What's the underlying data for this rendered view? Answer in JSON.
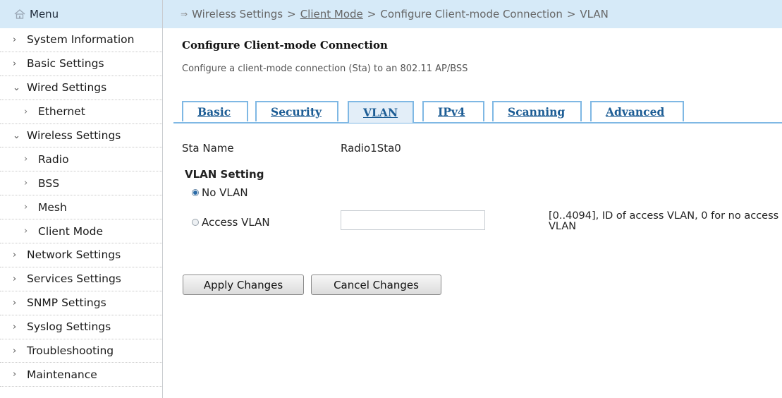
{
  "sidebar": {
    "header_label": "Menu",
    "items": [
      {
        "label": "System Information",
        "chevron": ">"
      },
      {
        "label": "Basic Settings",
        "chevron": ">"
      },
      {
        "label": "Wired Settings",
        "chevron": "v"
      },
      {
        "label": "Ethernet",
        "chevron": ">"
      },
      {
        "label": "Wireless Settings",
        "chevron": "v"
      },
      {
        "label": "Radio",
        "chevron": ">"
      },
      {
        "label": "BSS",
        "chevron": ">"
      },
      {
        "label": "Mesh",
        "chevron": ">"
      },
      {
        "label": "Client Mode",
        "chevron": ">"
      },
      {
        "label": "Network Settings",
        "chevron": ">"
      },
      {
        "label": "Services Settings",
        "chevron": ">"
      },
      {
        "label": "SNMP Settings",
        "chevron": ">"
      },
      {
        "label": "Syslog Settings",
        "chevron": ">"
      },
      {
        "label": "Troubleshooting",
        "chevron": ">"
      },
      {
        "label": "Maintenance",
        "chevron": ">"
      }
    ]
  },
  "breadcrumb": {
    "items": [
      "Wireless Settings",
      "Client Mode",
      "Configure Client-mode Connection",
      "VLAN"
    ],
    "separator": ">"
  },
  "page": {
    "title": "Configure Client-mode Connection",
    "description": "Configure a client-mode connection (Sta) to an 802.11 AP/BSS"
  },
  "tabs": [
    {
      "label": "Basic",
      "active": false
    },
    {
      "label": "Security",
      "active": false
    },
    {
      "label": "VLAN",
      "active": true
    },
    {
      "label": "IPv4",
      "active": false
    },
    {
      "label": "Scanning",
      "active": false
    },
    {
      "label": "Advanced",
      "active": false
    }
  ],
  "form": {
    "sta_name_label": "Sta Name",
    "sta_name_value": "Radio1Sta0",
    "vlan_setting_title": "VLAN Setting",
    "no_vlan_label": "No VLAN",
    "no_vlan_selected": true,
    "access_vlan_label": "Access VLAN",
    "access_vlan_selected": false,
    "access_vlan_value": "",
    "access_vlan_hint": "[0..4094], ID of access VLAN, 0 for no access VLAN"
  },
  "buttons": {
    "apply_label": "Apply Changes",
    "cancel_label": "Cancel Changes"
  },
  "colors": {
    "header_bg": "#d6eaf8",
    "tab_border": "#7fb8e4",
    "tab_text": "#1d5d95",
    "active_tab_bg": "#e3eef8"
  },
  "icons": {
    "menu": "home-icon",
    "breadcrumb": "arrow-icon",
    "expanded": "chevron-down-icon",
    "collapsed": "chevron-right-icon"
  }
}
